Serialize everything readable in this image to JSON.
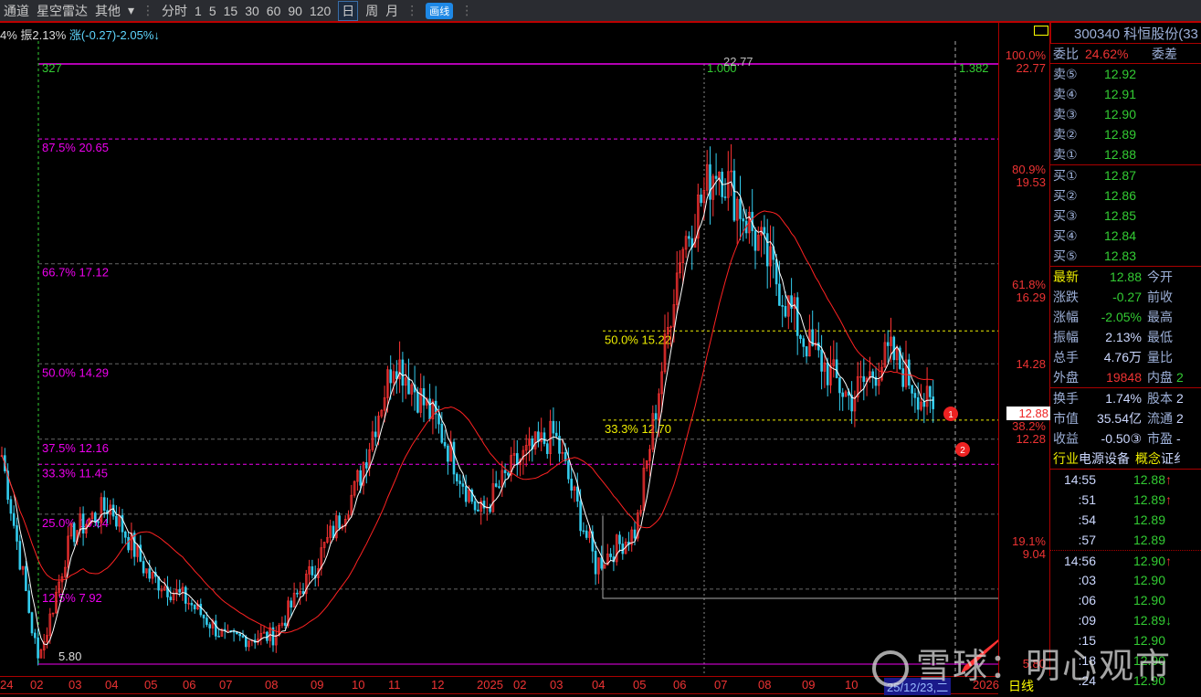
{
  "toolbar": {
    "items": [
      "通道",
      "星空雷达",
      "其他",
      "▾",
      "分时",
      "1",
      "5",
      "15",
      "30",
      "60",
      "90",
      "120",
      "日",
      "周",
      "月"
    ],
    "active": "日",
    "draw": "画线"
  },
  "infoline": {
    "prefix": "4%",
    "amp": "振2.13%",
    "chg": "涨(-0.27)-2.05%↓"
  },
  "chart_labels": {
    "top_left": "327",
    "high_label": "1.000",
    "high_price": "22.77",
    "right_top": "1.382",
    "low_price": "5.80",
    "marker1": "1",
    "marker2": "2"
  },
  "fib_left": [
    {
      "label": "87.5% 20.65",
      "price": 20.65,
      "color": "#e0e"
    },
    {
      "label": "66.7% 17.12",
      "price": 17.12,
      "color": "#666"
    },
    {
      "label": "50.0% 14.29",
      "price": 14.29,
      "color": "#666"
    },
    {
      "label": "37.5% 12.16",
      "price": 12.16,
      "color": "#666"
    },
    {
      "label": "33.3% 11.45",
      "price": 11.45,
      "color": "#e0e"
    },
    {
      "label": "25.0% 10.04",
      "price": 10.04,
      "color": "#666"
    },
    {
      "label": "12.5% 7.92",
      "price": 7.92,
      "color": "#666"
    }
  ],
  "fib_right": [
    {
      "label": "50.0% 15.22",
      "price": 15.22
    },
    {
      "label": "33.3% 12.70",
      "price": 12.7
    }
  ],
  "axis": [
    {
      "pct": "100.0%",
      "price": "22.77",
      "p": 22.77
    },
    {
      "pct": "80.9%",
      "price": "19.53",
      "p": 19.53
    },
    {
      "pct": "61.8%",
      "price": "16.29",
      "p": 16.29
    },
    {
      "pct": "",
      "price": "14.28",
      "p": 14.28
    },
    {
      "pct": "38.2%",
      "price": "12.28",
      "p": 12.28
    },
    {
      "pct": "19.1%",
      "price": "9.04",
      "p": 9.04
    },
    {
      "pct": "",
      "price": "5.80",
      "p": 5.8
    }
  ],
  "current_price": "12.88",
  "time_ticks": [
    "24",
    "02",
    "03",
    "04",
    "05",
    "06",
    "07",
    "08",
    "09",
    "10",
    "11",
    "12",
    "2025",
    "02",
    "03",
    "04",
    "05",
    "06",
    "07",
    "08",
    "09",
    "10",
    "25/12/23,二",
    "2026"
  ],
  "period_label": "日线",
  "panel": {
    "title": "300340 科恒股份(33",
    "ratio_label": "委比",
    "ratio": "24.62%",
    "diff_label": "委差",
    "asks": [
      [
        "卖⑤",
        "12.92"
      ],
      [
        "卖④",
        "12.91"
      ],
      [
        "卖③",
        "12.90"
      ],
      [
        "卖②",
        "12.89"
      ],
      [
        "卖①",
        "12.88"
      ]
    ],
    "bids": [
      [
        "买①",
        "12.87"
      ],
      [
        "买②",
        "12.86"
      ],
      [
        "买③",
        "12.85"
      ],
      [
        "买④",
        "12.84"
      ],
      [
        "买⑤",
        "12.83"
      ]
    ],
    "stats": [
      [
        "最新",
        "12.88",
        "今开",
        ""
      ],
      [
        "涨跌",
        "-0.27",
        "前收",
        ""
      ],
      [
        "涨幅",
        "-2.05%",
        "最高",
        ""
      ],
      [
        "振幅",
        "2.13%",
        "最低",
        ""
      ],
      [
        "总手",
        "4.76万",
        "量比",
        ""
      ],
      [
        "外盘",
        "19848",
        "内盘",
        "2"
      ]
    ],
    "stats2": [
      [
        "换手",
        "1.74%",
        "股本",
        "2"
      ],
      [
        "市值",
        "35.54亿",
        "流通",
        "2"
      ],
      [
        "收益",
        "-0.50③",
        "市盈",
        "-"
      ]
    ],
    "industry_label": "行业",
    "industry": "电源设备",
    "concept_label": "概念",
    "concept": "证纟",
    "ticks": [
      [
        "14:55",
        "12.88",
        "↑"
      ],
      [
        ":51",
        "12.89",
        "↑"
      ],
      [
        ":54",
        "12.89",
        ""
      ],
      [
        ":57",
        "12.89",
        ""
      ],
      [
        "14:56",
        "12.90",
        "↑"
      ],
      [
        ":03",
        "12.90",
        ""
      ],
      [
        ":06",
        "12.90",
        ""
      ],
      [
        ":09",
        "12.89",
        "↓"
      ],
      [
        ":15",
        "12.90",
        ""
      ],
      [
        ":18",
        "12.90",
        ""
      ],
      [
        ":24",
        "12.90",
        ""
      ]
    ]
  },
  "watermark": "雪球：明心观市",
  "chart_data": {
    "type": "candlestick",
    "ylim": [
      5.8,
      22.77
    ],
    "keypoints": [
      [
        "2024-01",
        12.0
      ],
      [
        "2024-02",
        5.8
      ],
      [
        "2024-03",
        9.5
      ],
      [
        "2024-04",
        10.3
      ],
      [
        "2024-05",
        8.3
      ],
      [
        "2024-06",
        7.6
      ],
      [
        "2024-07",
        6.5
      ],
      [
        "2024-08",
        6.6
      ],
      [
        "2024-09",
        8.6
      ],
      [
        "2024-10",
        10.8
      ],
      [
        "2024-11",
        14.5
      ],
      [
        "2024-12",
        12.6
      ],
      [
        "2025-01",
        10.0
      ],
      [
        "2025-02",
        11.5
      ],
      [
        "2025-03",
        12.3
      ],
      [
        "2025-04",
        8.6
      ],
      [
        "2025-05",
        9.6
      ],
      [
        "2025-06",
        17.5
      ],
      [
        "2025-07",
        20.0
      ],
      [
        "2025-08",
        17.5
      ],
      [
        "2025-09",
        15.0
      ],
      [
        "2025-10",
        13.3
      ],
      [
        "2025-11",
        14.6
      ],
      [
        "2025-12",
        12.88
      ]
    ],
    "colors": {
      "up": "#ff3333",
      "down": "#33ccee",
      "ma_short": "#ffffff",
      "ma_long": "#ff2222"
    }
  }
}
